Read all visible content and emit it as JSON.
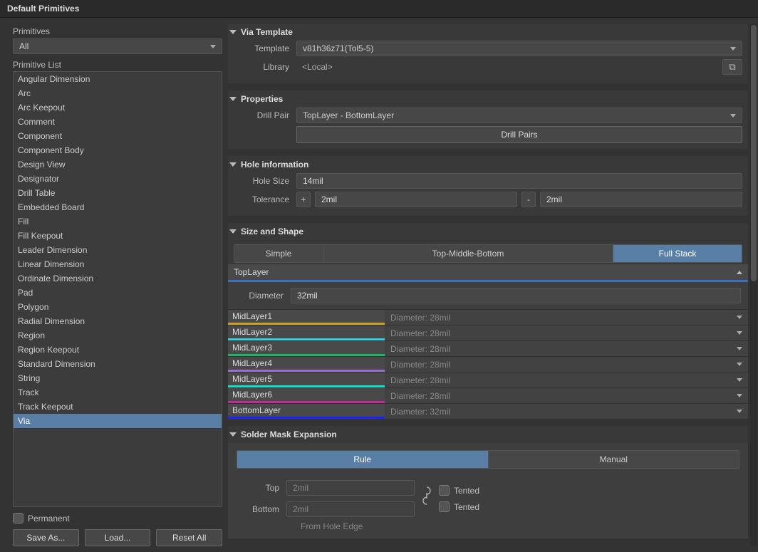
{
  "title": "Default Primitives",
  "left": {
    "primitives_label": "Primitives",
    "dropdown": "All",
    "list_label": "Primitive List",
    "items": [
      "Angular Dimension",
      "Arc",
      "Arc Keepout",
      "Comment",
      "Component",
      "Component Body",
      "Design View",
      "Designator",
      "Drill Table",
      "Embedded Board",
      "Fill",
      "Fill Keepout",
      "Leader Dimension",
      "Linear Dimension",
      "Ordinate Dimension",
      "Pad",
      "Polygon",
      "Radial Dimension",
      "Region",
      "Region Keepout",
      "Standard Dimension",
      "String",
      "Track",
      "Track Keepout",
      "Via"
    ],
    "selected": "Via",
    "permanent": "Permanent",
    "save_as": "Save As...",
    "load": "Load...",
    "reset_all": "Reset All"
  },
  "via_template": {
    "title": "Via Template",
    "template_label": "Template",
    "template_value": "v81h36z71(Tol5-5)",
    "library_label": "Library",
    "library_value": "<Local>"
  },
  "properties": {
    "title": "Properties",
    "drill_pair_label": "Drill Pair",
    "drill_pair_value": "TopLayer - BottomLayer",
    "drill_pairs_btn": "Drill Pairs"
  },
  "hole": {
    "title": "Hole information",
    "size_label": "Hole Size",
    "size_value": "14mil",
    "tol_label": "Tolerance",
    "tol_plus": "+",
    "tol_plus_val": "2mil",
    "tol_minus": "-",
    "tol_minus_val": "2mil"
  },
  "size_shape": {
    "title": "Size and Shape",
    "tabs": [
      "Simple",
      "Top-Middle-Bottom",
      "Full Stack"
    ],
    "active_tab": "Full Stack",
    "top_layer": "TopLayer",
    "diameter_label": "Diameter",
    "diameter_value": "32mil",
    "layers": [
      {
        "name": "MidLayer1",
        "color": "#c9a227",
        "diam": "Diameter: 28mil"
      },
      {
        "name": "MidLayer2",
        "color": "#2fd0e0",
        "diam": "Diameter: 28mil"
      },
      {
        "name": "MidLayer3",
        "color": "#21b567",
        "diam": "Diameter: 28mil"
      },
      {
        "name": "MidLayer4",
        "color": "#9e6bd1",
        "diam": "Diameter: 28mil"
      },
      {
        "name": "MidLayer5",
        "color": "#15e1c7",
        "diam": "Diameter: 28mil"
      },
      {
        "name": "MidLayer6",
        "color": "#c12a94",
        "diam": "Diameter: 28mil"
      },
      {
        "name": "BottomLayer",
        "color": "#1922ff",
        "diam": "Diameter: 32mil"
      }
    ]
  },
  "solder": {
    "title": "Solder Mask Expansion",
    "rule": "Rule",
    "manual": "Manual",
    "top": "Top",
    "bottom": "Bottom",
    "top_val": "2mil",
    "bottom_val": "2mil",
    "tented": "Tented",
    "from_hole": "From Hole Edge"
  }
}
